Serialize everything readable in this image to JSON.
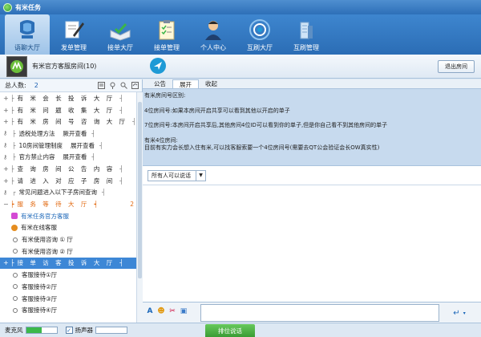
{
  "window": {
    "title": "有米任务"
  },
  "toolbar": {
    "items": [
      {
        "label": "语聊大厅",
        "icon": "mic-icon",
        "active": true
      },
      {
        "label": "发单管理",
        "icon": "sign-document-icon"
      },
      {
        "label": "接单大厅",
        "icon": "receive-order-icon"
      },
      {
        "label": "接单管理",
        "icon": "clipboard-icon"
      },
      {
        "label": "个人中心",
        "icon": "user-icon"
      },
      {
        "label": "互刷大厅",
        "icon": "target-icon"
      },
      {
        "label": "互刷管理",
        "icon": "building-icon"
      }
    ]
  },
  "room": {
    "name": "有米官方客服房间(10)",
    "exit_label": "退出房间"
  },
  "left_panel": {
    "total_label": "总人数:",
    "total_count": "2",
    "tree": [
      {
        "label": "有 米 会 长 投 诉 大 厅",
        "style": "spaced"
      },
      {
        "label": "有 米 问 题 收 集 大 厅",
        "style": "spaced"
      },
      {
        "label": "有 米 房 间 号 咨 询 大 厅",
        "style": "spaced"
      },
      {
        "label": "透税处理方法　 厥开查看",
        "style": "key"
      },
      {
        "label": "10房间管理制度　 展开查看",
        "style": "key"
      },
      {
        "label": "官方禁止内容　 展开查看",
        "style": "key"
      },
      {
        "label": "查 询 房 间 公 告 内 容",
        "style": "spaced"
      },
      {
        "label": "请 进 入 对 应 子 房 间",
        "style": "spaced"
      },
      {
        "label": "常见问题进入以下子房间查询",
        "style": "normal"
      },
      {
        "label": "服 务 等 待 大 厅",
        "style": "orange",
        "count": "2"
      },
      {
        "label": "有米任务官方客服",
        "style": "gift"
      },
      {
        "label": "有米在线客服",
        "style": "person"
      },
      {
        "label": "有米使用咨询 ① 厅",
        "style": "bullet"
      },
      {
        "label": "有米使用咨询 ② 厅",
        "style": "bullet"
      },
      {
        "label": "接 单 访 客 投 诉 大 厅",
        "style": "sel"
      },
      {
        "label": "客服接待①厅",
        "style": "bullet"
      },
      {
        "label": "客服接待②厅",
        "style": "bullet"
      },
      {
        "label": "客服接待③厅",
        "style": "bullet"
      },
      {
        "label": "客服接待④厅",
        "style": "bullet"
      }
    ]
  },
  "tabs": [
    {
      "label": "公告",
      "active": false
    },
    {
      "label": "展开",
      "active": true
    },
    {
      "label": "收起",
      "active": false
    }
  ],
  "notice": {
    "line1": "有米房间号区别:",
    "line2": "4位房间号:如果本房间开启共享可以看到其他以开启的单子",
    "line3": "7位房间号:本房间开启共享后,其他房间4位ID可以看到你的单子,但是你自己看不到其他房间的单子",
    "line4": "有米4位房间:",
    "line5": "目前有实力会长想入住有米,可以找客服索要一个4位房间号(需要去QT公会验证会长OW真实性)"
  },
  "chat": {
    "target_select": "所有人可以说话"
  },
  "status": {
    "mic_label": "麦克风",
    "speaker_label": "扬声器",
    "queue_button": "排位说话",
    "mic_level": 0.5,
    "speaker_checked": true
  }
}
